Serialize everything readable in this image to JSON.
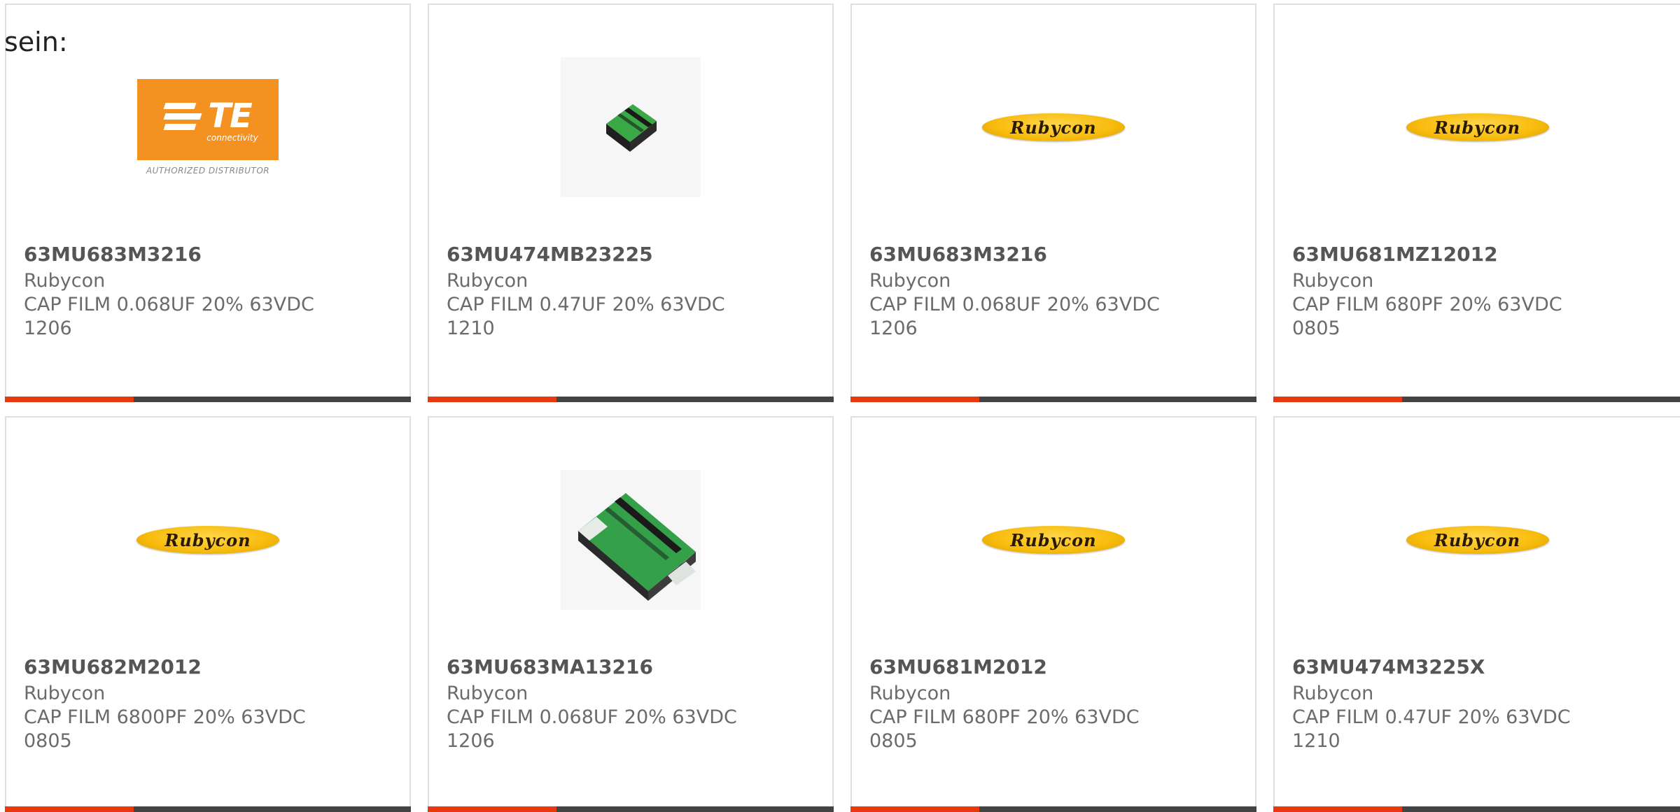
{
  "intro_text": "sein:",
  "products": [
    {
      "part": "63MU683M3216",
      "manufacturer": "Rubycon",
      "description": "CAP FILM 0.068UF 20% 63VDC",
      "package": "1206",
      "image": "te-connectivity-logo",
      "logo_main": "TE",
      "logo_sub": "connectivity",
      "logo_caption": "AUTHORIZED DISTRIBUTOR"
    },
    {
      "part": "63MU474MB23225",
      "manufacturer": "Rubycon",
      "description": "CAP FILM 0.47UF 20% 63VDC",
      "package": "1210",
      "image": "small-film-chip"
    },
    {
      "part": "63MU683M3216",
      "manufacturer": "Rubycon",
      "description": "CAP FILM 0.068UF 20% 63VDC",
      "package": "1206",
      "image": "rubycon-logo",
      "logo_text": "Rubycon"
    },
    {
      "part": "63MU681MZ12012",
      "manufacturer": "Rubycon",
      "description": "CAP FILM 680PF 20% 63VDC",
      "package": "0805",
      "image": "rubycon-logo",
      "logo_text": "Rubycon"
    },
    {
      "part": "63MU682M2012",
      "manufacturer": "Rubycon",
      "description": "CAP FILM 6800PF 20% 63VDC",
      "package": "0805",
      "image": "rubycon-logo",
      "logo_text": "Rubycon"
    },
    {
      "part": "63MU683MA13216",
      "manufacturer": "Rubycon",
      "description": "CAP FILM 0.068UF 20% 63VDC",
      "package": "1206",
      "image": "large-film-chip"
    },
    {
      "part": "63MU681M2012",
      "manufacturer": "Rubycon",
      "description": "CAP FILM 680PF 20% 63VDC",
      "package": "0805",
      "image": "rubycon-logo",
      "logo_text": "Rubycon"
    },
    {
      "part": "63MU474M3225X",
      "manufacturer": "Rubycon",
      "description": "CAP FILM 0.47UF 20% 63VDC",
      "package": "1210",
      "image": "rubycon-logo",
      "logo_text": "Rubycon"
    }
  ],
  "colors": {
    "accent_bar": "#e8380d",
    "dark_bar": "#444444",
    "rubycon_yellow": "#f7bb0c",
    "te_orange": "#f39221",
    "text_grey": "#6b6b6b"
  }
}
